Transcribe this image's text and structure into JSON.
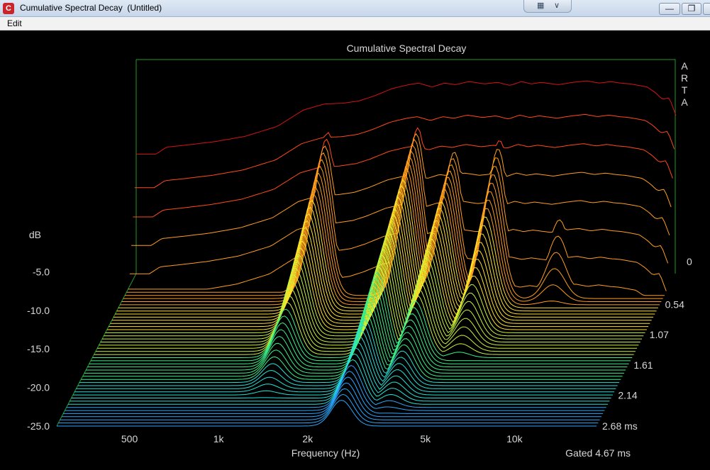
{
  "window": {
    "title": "Cumulative Spectral Decay  (Untitled)",
    "app_icon_glyph": "C"
  },
  "menu": {
    "items": [
      "Edit"
    ]
  },
  "chart_data": {
    "type": "waterfall",
    "title": "Cumulative Spectral Decay",
    "watermark": "ARTA",
    "xlabel": "Frequency (Hz)",
    "x_scale": "log",
    "x_ticks": [
      "500",
      "1k",
      "2k",
      "5k",
      "10k"
    ],
    "x_tick_values": [
      500,
      1000,
      2000,
      5000,
      10000
    ],
    "xlim": [
      300,
      20000
    ],
    "ylabel": "dB",
    "y_ticks": [
      "-5.0",
      "-10.0",
      "-15.0",
      "-20.0",
      "-25.0"
    ],
    "y_tick_values": [
      -5,
      -10,
      -15,
      -20,
      -25
    ],
    "ylim": [
      -25,
      0
    ],
    "z_ticks": [
      "0",
      "0.54",
      "1.07",
      "1.61",
      "2.14",
      "2.68 ms"
    ],
    "z_tick_values": [
      0,
      0.54,
      1.07,
      1.61,
      2.14,
      2.68
    ],
    "zlim": [
      0,
      2.68
    ],
    "gated_label": "Gated 4.67 ms",
    "slice_count": 50,
    "initial_response": {
      "freq": [
        350,
        380,
        450,
        550,
        700,
        900,
        1100,
        1300,
        1500,
        1700,
        1900,
        2200,
        2500,
        2700,
        3000,
        3300,
        3600,
        4000,
        4500,
        5000,
        5500,
        6000,
        6500,
        7000,
        8000,
        9000,
        10000,
        11000,
        12000,
        13000,
        14000,
        15000,
        16000,
        17000,
        18000,
        19000,
        20000
      ],
      "db": [
        -9.5,
        -8.6,
        -8.3,
        -7.9,
        -7.2,
        -5.9,
        -3.8,
        -3.0,
        -2.9,
        -2.6,
        -2.0,
        -1.0,
        -0.5,
        -0.3,
        -0.8,
        -0.3,
        -0.5,
        -0.1,
        -0.4,
        -0.2,
        -0.6,
        -0.1,
        -0.4,
        -0.2,
        -0.5,
        -0.2,
        0.0,
        -0.3,
        -0.1,
        -0.3,
        -0.4,
        -0.6,
        -0.8,
        -1.5,
        -2.4,
        -2.2,
        -4.5
      ]
    },
    "resonances": [
      {
        "freq": 1350,
        "db": -5.8,
        "decay_ms": 1.6
      },
      {
        "freq": 2750,
        "db": -4.6,
        "decay_ms": 2.2
      },
      {
        "freq": 3700,
        "db": -6.8,
        "decay_ms": 1.9
      },
      {
        "freq": 5200,
        "db": -5.5,
        "decay_ms": 1.1
      },
      {
        "freq": 8600,
        "db": -7.5,
        "decay_ms": 0.45
      },
      {
        "freq": 16000,
        "db": -8.5,
        "decay_ms": 0.15
      }
    ],
    "colors": [
      "#2e7fff",
      "#2aa8ff",
      "#26e0d8",
      "#3cf08a",
      "#c8f23a",
      "#ffe12a",
      "#ff9e1e",
      "#ff4a1a",
      "#d41414"
    ],
    "grid": false,
    "legend": "colorbar-left"
  }
}
